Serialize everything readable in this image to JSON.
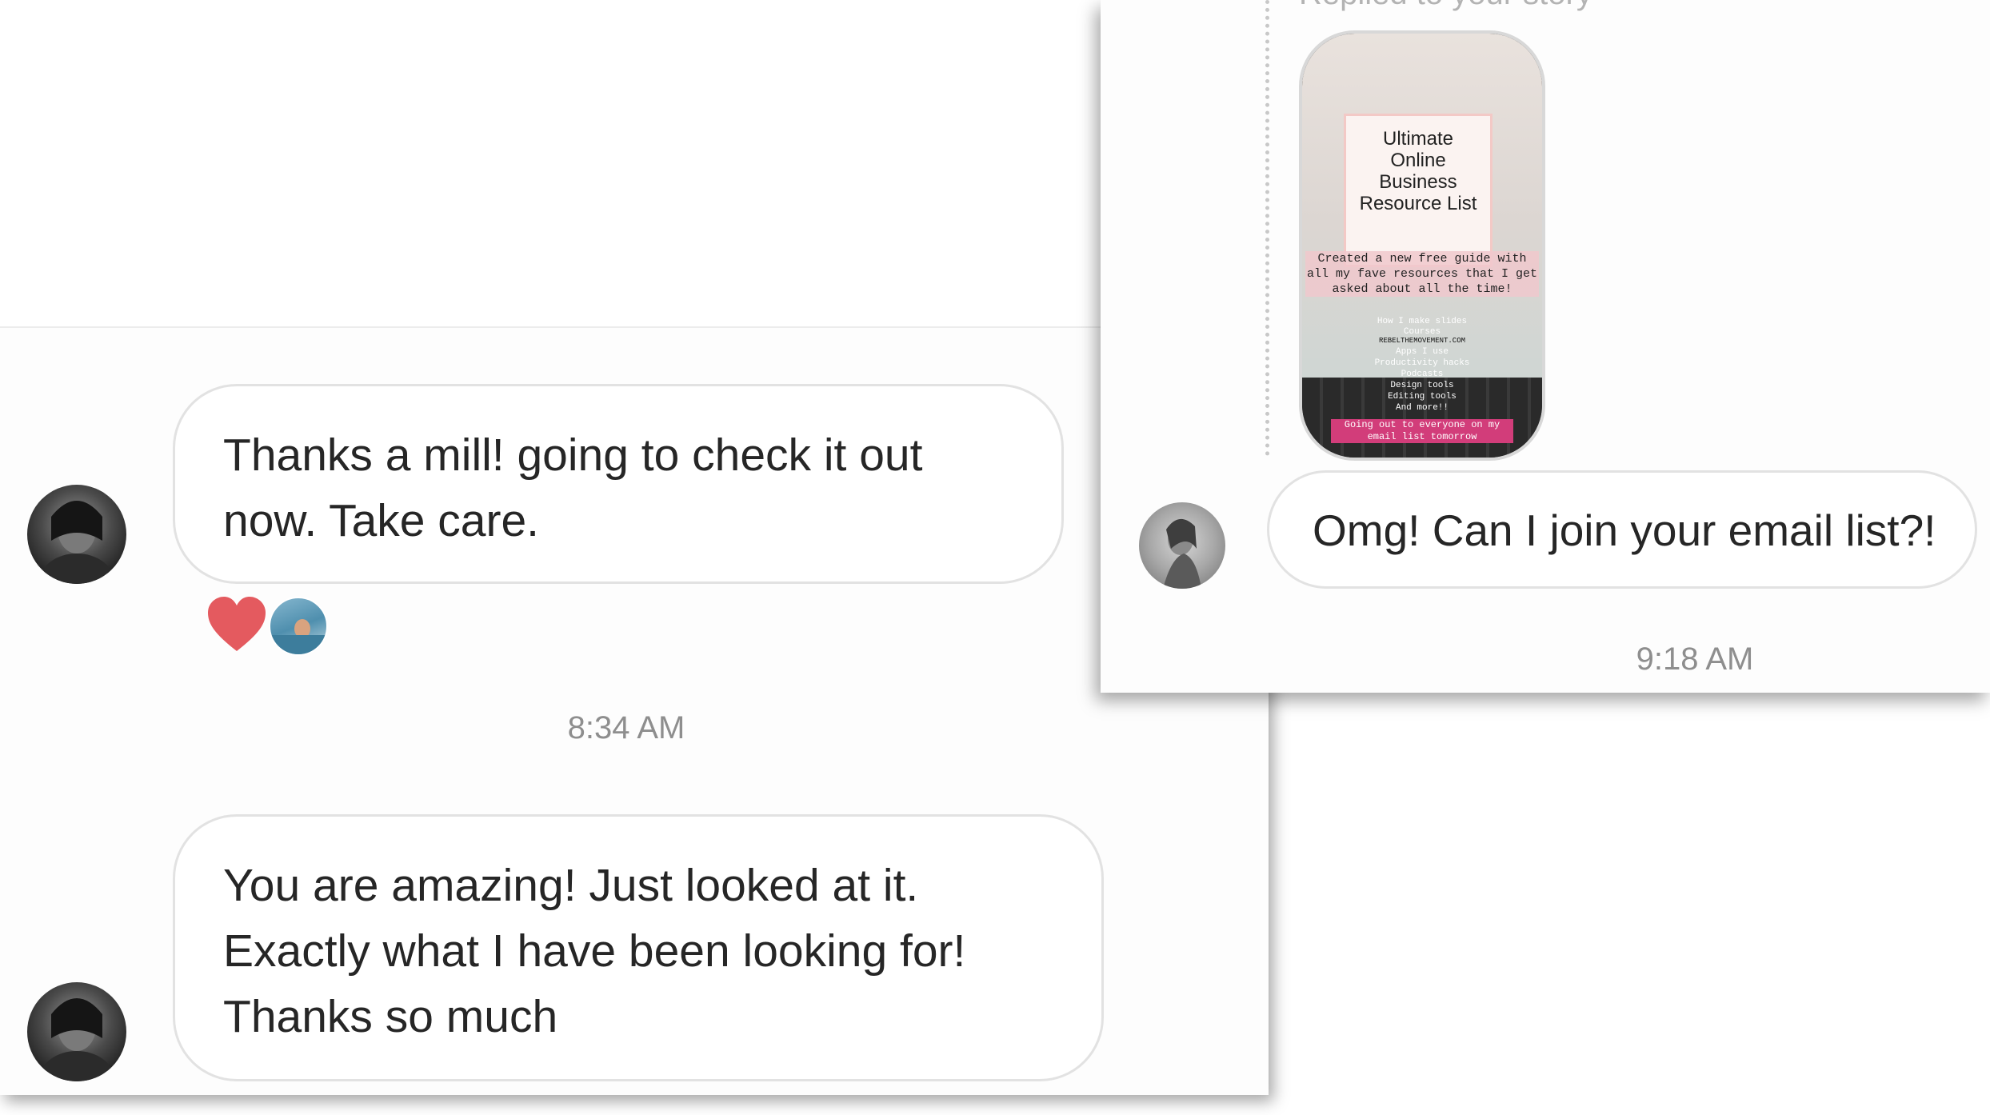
{
  "left_screenshot": {
    "messages": [
      {
        "text": "Thanks a mill! going to check it out now. Take care."
      },
      {
        "text": "You are amazing! Just looked at it. Exactly what I have been looking for! Thanks so much"
      }
    ],
    "reaction": {
      "icon": "heart-icon",
      "color": "#e45a5f"
    },
    "timestamp": "8:34 AM"
  },
  "right_screenshot": {
    "story_label": "Replied to your story",
    "story": {
      "title": "Ultimate Online Business Resource List",
      "subtitle": "Created a new free guide with all my fave resources that I get asked about all the time!",
      "items": [
        "How I make slides",
        "Courses",
        "Apps I use",
        "Productivity hacks",
        "Podcasts",
        "Design tools",
        "Editing tools",
        "And more!!"
      ],
      "brand": "REBELTHEMOVEMENT.COM",
      "footer": "Going out to everyone on my email list tomorrow"
    },
    "message": {
      "text": "Omg! Can I join your email list?!"
    },
    "timestamp": "9:18 AM"
  }
}
